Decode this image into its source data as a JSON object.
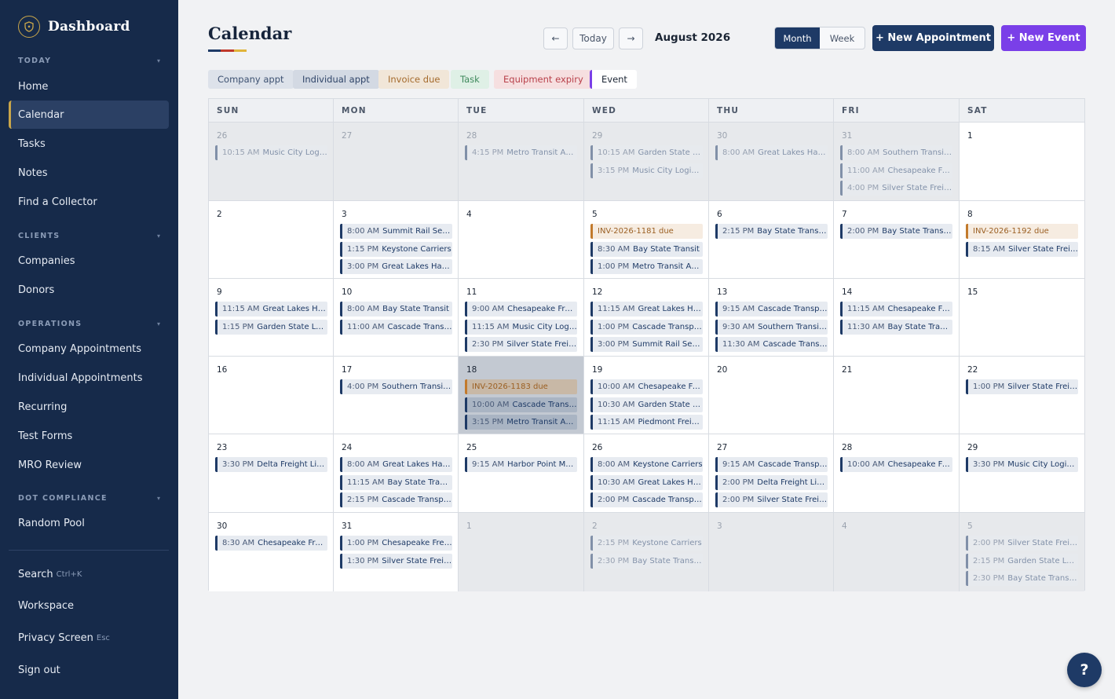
{
  "app": {
    "title": "Dashboard"
  },
  "colors": {
    "sidebar_bg": "#162a4a",
    "accent_gold": "#c9a64a",
    "navy": "#1e3a66",
    "purple": "#7a3fe8",
    "invoice": "#c27a2c"
  },
  "sidebar": {
    "sections": [
      {
        "label": "TODAY",
        "items": [
          "Home",
          "Calendar",
          "Tasks",
          "Notes",
          "Find a Collector"
        ]
      },
      {
        "label": "CLIENTS",
        "items": [
          "Companies",
          "Donors"
        ]
      },
      {
        "label": "OPERATIONS",
        "items": [
          "Company Appointments",
          "Individual Appointments",
          "Recurring",
          "Test Forms",
          "MRO Review"
        ]
      },
      {
        "label": "DOT COMPLIANCE",
        "items": [
          "Random Pool"
        ]
      }
    ],
    "active_item": "Calendar",
    "footer": [
      {
        "label": "Search",
        "hint": "Ctrl+K"
      },
      {
        "label": "Workspace",
        "hint": ""
      },
      {
        "label": "Privacy Screen",
        "hint": "Esc"
      },
      {
        "label": "Sign out",
        "hint": ""
      }
    ]
  },
  "header": {
    "title": "Calendar",
    "prev": "←",
    "today": "Today",
    "next": "→",
    "month_label": "August 2026",
    "view_month": "Month",
    "view_week": "Week",
    "new_appointment": "+ New Appointment",
    "new_event": "+ New Event"
  },
  "legend": [
    "Company appt",
    "Individual appt",
    "Invoice due",
    "Task",
    "Equipment expiry",
    "Event"
  ],
  "calendar": {
    "weekdays": [
      "SUN",
      "MON",
      "TUE",
      "WED",
      "THU",
      "FRI",
      "SAT"
    ],
    "selected_day": "18",
    "weeks": [
      [
        {
          "day": "26",
          "other": true,
          "events": [
            {
              "time": "10:15 AM",
              "text": "Music City Logistics"
            }
          ]
        },
        {
          "day": "27",
          "other": true,
          "events": []
        },
        {
          "day": "28",
          "other": true,
          "events": [
            {
              "time": "4:15 PM",
              "text": "Metro Transit Authority"
            }
          ]
        },
        {
          "day": "29",
          "other": true,
          "events": [
            {
              "time": "10:15 AM",
              "text": "Garden State Logistics"
            },
            {
              "time": "3:15 PM",
              "text": "Music City Logistics"
            }
          ]
        },
        {
          "day": "30",
          "other": true,
          "events": [
            {
              "time": "8:00 AM",
              "text": "Great Lakes Hauling"
            }
          ]
        },
        {
          "day": "31",
          "other": true,
          "events": [
            {
              "time": "8:00 AM",
              "text": "Southern Transit Co."
            },
            {
              "time": "11:00 AM",
              "text": "Chesapeake Freight"
            },
            {
              "time": "4:00 PM",
              "text": "Silver State Freight"
            }
          ]
        },
        {
          "day": "1",
          "other": false,
          "events": []
        }
      ],
      [
        {
          "day": "2",
          "other": false,
          "events": []
        },
        {
          "day": "3",
          "other": false,
          "events": [
            {
              "time": "8:00 AM",
              "text": "Summit Rail Services"
            },
            {
              "time": "1:15 PM",
              "text": "Keystone Carriers"
            },
            {
              "time": "3:00 PM",
              "text": "Great Lakes Hauling"
            }
          ]
        },
        {
          "day": "4",
          "other": false,
          "events": []
        },
        {
          "day": "5",
          "other": false,
          "events": [
            {
              "time": "",
              "text": "INV-2026-1181 due",
              "type": "invoice"
            },
            {
              "time": "8:30 AM",
              "text": "Bay State Transit"
            },
            {
              "time": "1:00 PM",
              "text": "Metro Transit Authority"
            }
          ]
        },
        {
          "day": "6",
          "other": false,
          "events": [
            {
              "time": "2:15 PM",
              "text": "Bay State Transit Co."
            }
          ]
        },
        {
          "day": "7",
          "other": false,
          "events": [
            {
              "time": "2:00 PM",
              "text": "Bay State Transit Co."
            }
          ]
        },
        {
          "day": "8",
          "other": false,
          "events": [
            {
              "time": "",
              "text": "INV-2026-1192 due",
              "type": "invoice"
            },
            {
              "time": "8:15 AM",
              "text": "Silver State Freight"
            }
          ]
        }
      ],
      [
        {
          "day": "9",
          "other": false,
          "events": [
            {
              "time": "11:15 AM",
              "text": "Great Lakes Hauling"
            },
            {
              "time": "1:15 PM",
              "text": "Garden State Logistics"
            }
          ]
        },
        {
          "day": "10",
          "other": false,
          "events": [
            {
              "time": "8:00 AM",
              "text": "Bay State Transit"
            },
            {
              "time": "11:00 AM",
              "text": "Cascade Transport"
            }
          ]
        },
        {
          "day": "11",
          "other": false,
          "events": [
            {
              "time": "9:00 AM",
              "text": "Chesapeake Freight"
            },
            {
              "time": "11:15 AM",
              "text": "Music City Logistics"
            },
            {
              "time": "2:30 PM",
              "text": "Silver State Freight"
            }
          ]
        },
        {
          "day": "12",
          "other": false,
          "events": [
            {
              "time": "11:15 AM",
              "text": "Great Lakes Hauling"
            },
            {
              "time": "1:00 PM",
              "text": "Cascade Transport"
            },
            {
              "time": "3:00 PM",
              "text": "Summit Rail Services"
            }
          ]
        },
        {
          "day": "13",
          "other": false,
          "events": [
            {
              "time": "9:15 AM",
              "text": "Cascade Transport"
            },
            {
              "time": "9:30 AM",
              "text": "Southern Transit Co."
            },
            {
              "time": "11:30 AM",
              "text": "Cascade Transport"
            }
          ]
        },
        {
          "day": "14",
          "other": false,
          "events": [
            {
              "time": "11:15 AM",
              "text": "Chesapeake Freight"
            },
            {
              "time": "11:30 AM",
              "text": "Bay State Transit"
            }
          ]
        },
        {
          "day": "15",
          "other": false,
          "events": []
        }
      ],
      [
        {
          "day": "16",
          "other": false,
          "events": []
        },
        {
          "day": "17",
          "other": false,
          "events": [
            {
              "time": "4:00 PM",
              "text": "Southern Transit Co."
            }
          ]
        },
        {
          "day": "18",
          "other": false,
          "selected": true,
          "events": [
            {
              "time": "",
              "text": "INV-2026-1183 due",
              "type": "invoice"
            },
            {
              "time": "10:00 AM",
              "text": "Cascade Transport"
            },
            {
              "time": "3:15 PM",
              "text": "Metro Transit Authority"
            }
          ]
        },
        {
          "day": "19",
          "other": false,
          "events": [
            {
              "time": "10:00 AM",
              "text": "Chesapeake Freight"
            },
            {
              "time": "10:30 AM",
              "text": "Garden State Logistics"
            },
            {
              "time": "11:15 AM",
              "text": "Piedmont Freight"
            }
          ]
        },
        {
          "day": "20",
          "other": false,
          "events": []
        },
        {
          "day": "21",
          "other": false,
          "events": []
        },
        {
          "day": "22",
          "other": false,
          "events": [
            {
              "time": "1:00 PM",
              "text": "Silver State Freight"
            }
          ]
        }
      ],
      [
        {
          "day": "23",
          "other": false,
          "events": [
            {
              "time": "3:30 PM",
              "text": "Delta Freight Lines"
            }
          ]
        },
        {
          "day": "24",
          "other": false,
          "events": [
            {
              "time": "8:00 AM",
              "text": "Great Lakes Hauling"
            },
            {
              "time": "11:15 AM",
              "text": "Bay State Transit"
            },
            {
              "time": "2:15 PM",
              "text": "Cascade Transport"
            }
          ]
        },
        {
          "day": "25",
          "other": false,
          "events": [
            {
              "time": "9:15 AM",
              "text": "Harbor Point Marine"
            }
          ]
        },
        {
          "day": "26",
          "other": false,
          "events": [
            {
              "time": "8:00 AM",
              "text": "Keystone Carriers"
            },
            {
              "time": "10:30 AM",
              "text": "Great Lakes Hauling"
            },
            {
              "time": "2:00 PM",
              "text": "Cascade Transport"
            }
          ]
        },
        {
          "day": "27",
          "other": false,
          "events": [
            {
              "time": "9:15 AM",
              "text": "Cascade Transport"
            },
            {
              "time": "2:00 PM",
              "text": "Delta Freight Lines"
            },
            {
              "time": "2:00 PM",
              "text": "Silver State Freight"
            }
          ]
        },
        {
          "day": "28",
          "other": false,
          "events": [
            {
              "time": "10:00 AM",
              "text": "Chesapeake Freight"
            }
          ]
        },
        {
          "day": "29",
          "other": false,
          "events": [
            {
              "time": "3:30 PM",
              "text": "Music City Logistics"
            }
          ]
        }
      ],
      [
        {
          "day": "30",
          "other": false,
          "events": [
            {
              "time": "8:30 AM",
              "text": "Chesapeake Freight"
            }
          ]
        },
        {
          "day": "31",
          "other": false,
          "events": [
            {
              "time": "1:00 PM",
              "text": "Chesapeake Freight"
            },
            {
              "time": "1:30 PM",
              "text": "Silver State Freight"
            }
          ]
        },
        {
          "day": "1",
          "other": true,
          "events": []
        },
        {
          "day": "2",
          "other": true,
          "events": [
            {
              "time": "2:15 PM",
              "text": "Keystone Carriers"
            },
            {
              "time": "2:30 PM",
              "text": "Bay State Transit Co."
            }
          ]
        },
        {
          "day": "3",
          "other": true,
          "events": []
        },
        {
          "day": "4",
          "other": true,
          "events": []
        },
        {
          "day": "5",
          "other": true,
          "events": [
            {
              "time": "2:00 PM",
              "text": "Silver State Freight"
            },
            {
              "time": "2:15 PM",
              "text": "Garden State Logistics"
            },
            {
              "time": "2:30 PM",
              "text": "Bay State Transit Co."
            }
          ]
        }
      ]
    ]
  },
  "help": "?"
}
